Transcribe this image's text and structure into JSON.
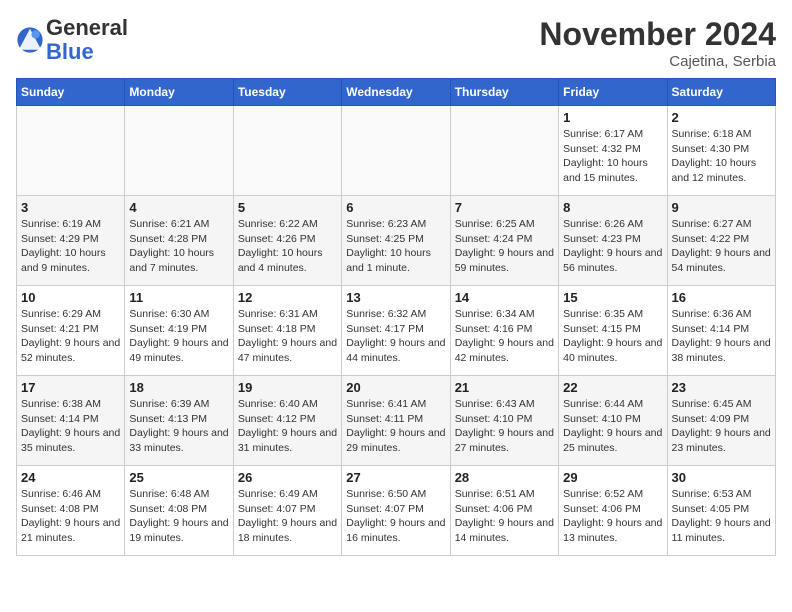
{
  "header": {
    "logo_general": "General",
    "logo_blue": "Blue",
    "month_title": "November 2024",
    "location": "Cajetina, Serbia"
  },
  "weekdays": [
    "Sunday",
    "Monday",
    "Tuesday",
    "Wednesday",
    "Thursday",
    "Friday",
    "Saturday"
  ],
  "weeks": [
    [
      {
        "day": "",
        "info": ""
      },
      {
        "day": "",
        "info": ""
      },
      {
        "day": "",
        "info": ""
      },
      {
        "day": "",
        "info": ""
      },
      {
        "day": "",
        "info": ""
      },
      {
        "day": "1",
        "info": "Sunrise: 6:17 AM\nSunset: 4:32 PM\nDaylight: 10 hours and 15 minutes."
      },
      {
        "day": "2",
        "info": "Sunrise: 6:18 AM\nSunset: 4:30 PM\nDaylight: 10 hours and 12 minutes."
      }
    ],
    [
      {
        "day": "3",
        "info": "Sunrise: 6:19 AM\nSunset: 4:29 PM\nDaylight: 10 hours and 9 minutes."
      },
      {
        "day": "4",
        "info": "Sunrise: 6:21 AM\nSunset: 4:28 PM\nDaylight: 10 hours and 7 minutes."
      },
      {
        "day": "5",
        "info": "Sunrise: 6:22 AM\nSunset: 4:26 PM\nDaylight: 10 hours and 4 minutes."
      },
      {
        "day": "6",
        "info": "Sunrise: 6:23 AM\nSunset: 4:25 PM\nDaylight: 10 hours and 1 minute."
      },
      {
        "day": "7",
        "info": "Sunrise: 6:25 AM\nSunset: 4:24 PM\nDaylight: 9 hours and 59 minutes."
      },
      {
        "day": "8",
        "info": "Sunrise: 6:26 AM\nSunset: 4:23 PM\nDaylight: 9 hours and 56 minutes."
      },
      {
        "day": "9",
        "info": "Sunrise: 6:27 AM\nSunset: 4:22 PM\nDaylight: 9 hours and 54 minutes."
      }
    ],
    [
      {
        "day": "10",
        "info": "Sunrise: 6:29 AM\nSunset: 4:21 PM\nDaylight: 9 hours and 52 minutes."
      },
      {
        "day": "11",
        "info": "Sunrise: 6:30 AM\nSunset: 4:19 PM\nDaylight: 9 hours and 49 minutes."
      },
      {
        "day": "12",
        "info": "Sunrise: 6:31 AM\nSunset: 4:18 PM\nDaylight: 9 hours and 47 minutes."
      },
      {
        "day": "13",
        "info": "Sunrise: 6:32 AM\nSunset: 4:17 PM\nDaylight: 9 hours and 44 minutes."
      },
      {
        "day": "14",
        "info": "Sunrise: 6:34 AM\nSunset: 4:16 PM\nDaylight: 9 hours and 42 minutes."
      },
      {
        "day": "15",
        "info": "Sunrise: 6:35 AM\nSunset: 4:15 PM\nDaylight: 9 hours and 40 minutes."
      },
      {
        "day": "16",
        "info": "Sunrise: 6:36 AM\nSunset: 4:14 PM\nDaylight: 9 hours and 38 minutes."
      }
    ],
    [
      {
        "day": "17",
        "info": "Sunrise: 6:38 AM\nSunset: 4:14 PM\nDaylight: 9 hours and 35 minutes."
      },
      {
        "day": "18",
        "info": "Sunrise: 6:39 AM\nSunset: 4:13 PM\nDaylight: 9 hours and 33 minutes."
      },
      {
        "day": "19",
        "info": "Sunrise: 6:40 AM\nSunset: 4:12 PM\nDaylight: 9 hours and 31 minutes."
      },
      {
        "day": "20",
        "info": "Sunrise: 6:41 AM\nSunset: 4:11 PM\nDaylight: 9 hours and 29 minutes."
      },
      {
        "day": "21",
        "info": "Sunrise: 6:43 AM\nSunset: 4:10 PM\nDaylight: 9 hours and 27 minutes."
      },
      {
        "day": "22",
        "info": "Sunrise: 6:44 AM\nSunset: 4:10 PM\nDaylight: 9 hours and 25 minutes."
      },
      {
        "day": "23",
        "info": "Sunrise: 6:45 AM\nSunset: 4:09 PM\nDaylight: 9 hours and 23 minutes."
      }
    ],
    [
      {
        "day": "24",
        "info": "Sunrise: 6:46 AM\nSunset: 4:08 PM\nDaylight: 9 hours and 21 minutes."
      },
      {
        "day": "25",
        "info": "Sunrise: 6:48 AM\nSunset: 4:08 PM\nDaylight: 9 hours and 19 minutes."
      },
      {
        "day": "26",
        "info": "Sunrise: 6:49 AM\nSunset: 4:07 PM\nDaylight: 9 hours and 18 minutes."
      },
      {
        "day": "27",
        "info": "Sunrise: 6:50 AM\nSunset: 4:07 PM\nDaylight: 9 hours and 16 minutes."
      },
      {
        "day": "28",
        "info": "Sunrise: 6:51 AM\nSunset: 4:06 PM\nDaylight: 9 hours and 14 minutes."
      },
      {
        "day": "29",
        "info": "Sunrise: 6:52 AM\nSunset: 4:06 PM\nDaylight: 9 hours and 13 minutes."
      },
      {
        "day": "30",
        "info": "Sunrise: 6:53 AM\nSunset: 4:05 PM\nDaylight: 9 hours and 11 minutes."
      }
    ]
  ]
}
